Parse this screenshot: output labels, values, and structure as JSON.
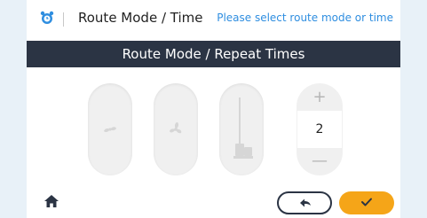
{
  "header": {
    "title": "Route Mode / Time",
    "hint": "Please select route mode or time",
    "icon": "alarm-clock-icon"
  },
  "subbar": {
    "label": "Route Mode / Repeat Times"
  },
  "modes": [
    {
      "name": "fan-low",
      "icon": "fan-icon"
    },
    {
      "name": "fan-high",
      "icon": "fan-icon"
    },
    {
      "name": "mop",
      "icon": "mop-icon"
    }
  ],
  "stepper": {
    "plus": "+",
    "value": "2",
    "minus": "—"
  },
  "footer": {
    "home_icon": "home-icon",
    "back_icon": "back-arrow-icon",
    "confirm_icon": "check-icon"
  },
  "colors": {
    "accent": "#f5a518",
    "dark_bar": "#2b3444",
    "hint": "#2f8ee0",
    "background": "#e8f1f8"
  }
}
